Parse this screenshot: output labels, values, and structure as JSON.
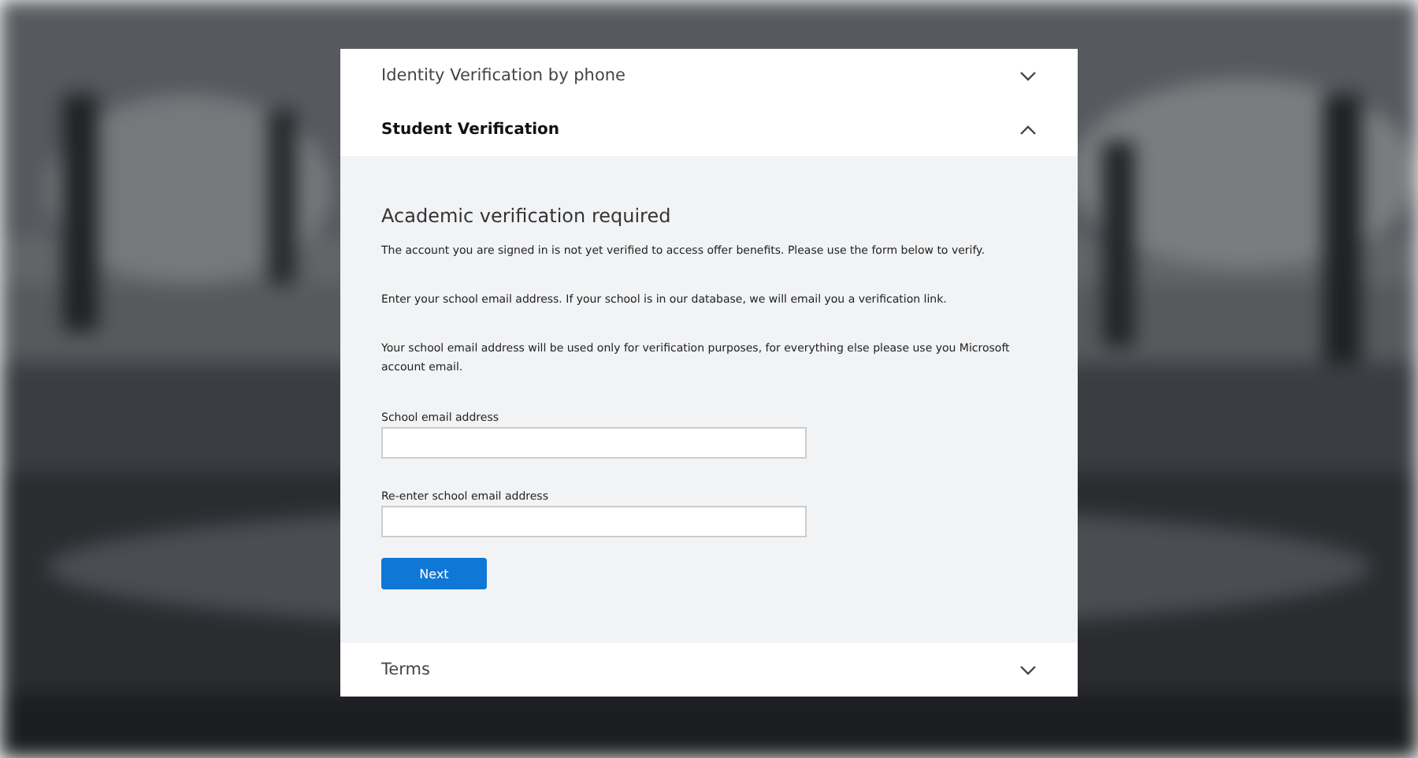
{
  "sections": [
    {
      "title": "Identity Verification by phone",
      "expanded": false
    },
    {
      "title": "Student Verification",
      "expanded": true,
      "content": {
        "heading": "Academic verification required",
        "paragraphs": [
          "The account you are signed in is not yet verified to access offer benefits. Please use the form below to verify.",
          "Enter your school email address. If your school is in our database, we will email you a verification link.",
          "Your school email address will be used only for verification purposes, for everything else please use you Microsoft account email."
        ],
        "fields": [
          {
            "label": "School email address"
          },
          {
            "label": "Re-enter school email address"
          }
        ],
        "button": "Next"
      }
    },
    {
      "title": "Terms",
      "expanded": false
    }
  ]
}
